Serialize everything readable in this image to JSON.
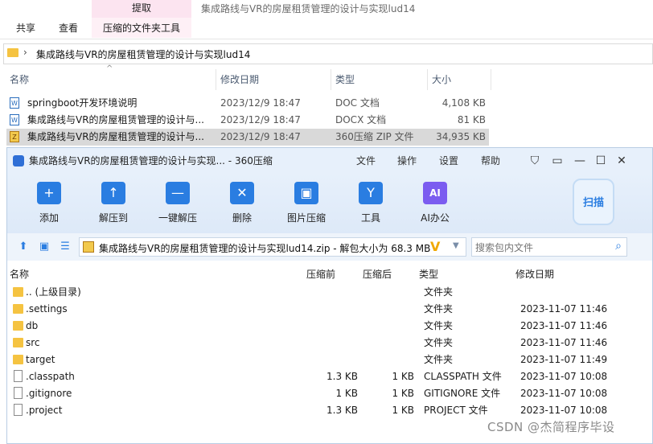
{
  "explorer": {
    "ribbon": {
      "extract_tab": "提取",
      "window_title": "集成路线与VR的房屋租赁管理的设计与实现lud14",
      "tabs": [
        "共享",
        "查看"
      ],
      "context_tab": "压缩的文件夹工具"
    },
    "address_path": "集成路线与VR的房屋租赁管理的设计与实现lud14",
    "columns": {
      "name": "名称",
      "modified": "修改日期",
      "type": "类型",
      "size": "大小"
    },
    "files": [
      {
        "name": "springboot开发环境说明",
        "modified": "2023/12/9 18:47",
        "type": "DOC 文档",
        "size": "4,108 KB",
        "icon": "word-doc-icon"
      },
      {
        "name": "集成路线与VR的房屋租赁管理的设计与...",
        "modified": "2023/12/9 18:47",
        "type": "DOCX 文档",
        "size": "81 KB",
        "icon": "word-doc-icon"
      },
      {
        "name": "集成路线与VR的房屋租赁管理的设计与...",
        "modified": "2023/12/9 18:47",
        "type": "360压缩 ZIP 文件",
        "size": "34,935 KB",
        "icon": "zip-icon"
      }
    ]
  },
  "zip_window": {
    "title": "集成路线与VR的房屋租赁管理的设计与实现... - 360压缩",
    "menu": [
      "文件",
      "操作",
      "设置",
      "帮助"
    ],
    "toolbar": [
      {
        "label": "添加",
        "icon": "add-icon",
        "glyph": "+"
      },
      {
        "label": "解压到",
        "icon": "extract-to-icon",
        "glyph": "↑"
      },
      {
        "label": "一键解压",
        "icon": "one-click-extract-icon",
        "glyph": "—"
      },
      {
        "label": "删除",
        "icon": "delete-icon",
        "glyph": "✕"
      },
      {
        "label": "图片压缩",
        "icon": "image-compress-icon",
        "glyph": "▣"
      },
      {
        "label": "工具",
        "icon": "tools-icon",
        "glyph": "Y"
      },
      {
        "label": "AI办公",
        "icon": "ai-office-icon",
        "glyph": "AI"
      }
    ],
    "scan_label": "扫描",
    "path_text": "集成路线与VR的房屋租赁管理的设计与实现lud14.zip - 解包大小为 68.3 MB",
    "search_placeholder": "搜索包内文件",
    "columns": {
      "name": "名称",
      "compressed_before": "压缩前",
      "compressed_after": "压缩后",
      "type": "类型",
      "modified": "修改日期"
    },
    "rows": [
      {
        "name": ".. (上级目录)",
        "before": "",
        "after": "",
        "type": "文件夹",
        "modified": "",
        "kind": "folder"
      },
      {
        "name": ".settings",
        "before": "",
        "after": "",
        "type": "文件夹",
        "modified": "2023-11-07 11:46",
        "kind": "folder"
      },
      {
        "name": "db",
        "before": "",
        "after": "",
        "type": "文件夹",
        "modified": "2023-11-07 11:46",
        "kind": "folder"
      },
      {
        "name": "src",
        "before": "",
        "after": "",
        "type": "文件夹",
        "modified": "2023-11-07 11:46",
        "kind": "folder"
      },
      {
        "name": "target",
        "before": "",
        "after": "",
        "type": "文件夹",
        "modified": "2023-11-07 11:49",
        "kind": "folder"
      },
      {
        "name": ".classpath",
        "before": "1.3 KB",
        "after": "1 KB",
        "type": "CLASSPATH 文件",
        "modified": "2023-11-07 10:08",
        "kind": "file"
      },
      {
        "name": ".gitignore",
        "before": "1 KB",
        "after": "1 KB",
        "type": "GITIGNORE 文件",
        "modified": "2023-11-07 10:08",
        "kind": "file"
      },
      {
        "name": ".project",
        "before": "1.3 KB",
        "after": "1 KB",
        "type": "PROJECT 文件",
        "modified": "2023-11-07 10:08",
        "kind": "file"
      }
    ]
  },
  "watermark": "CSDN @杰简程序毕设"
}
